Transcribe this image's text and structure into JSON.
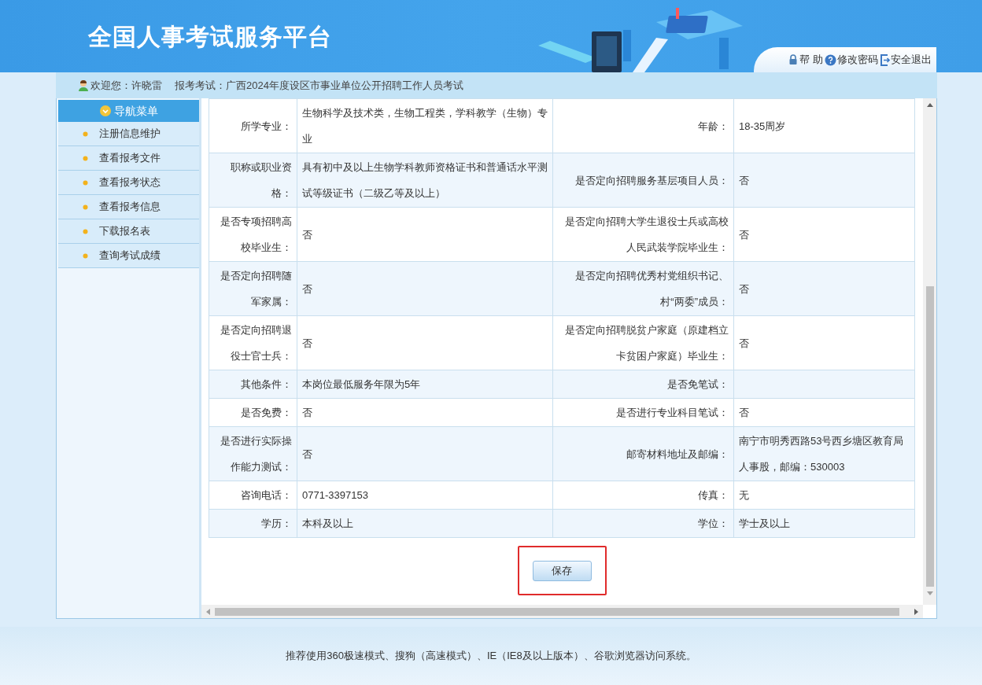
{
  "header": {
    "title": "全国人事考试服务平台",
    "links": [
      {
        "kind": "lock",
        "label": "帮 助"
      },
      {
        "kind": "help",
        "label": "修改密码"
      },
      {
        "kind": "exit",
        "label": "安全退出"
      }
    ]
  },
  "info_bar": {
    "welcome": "欢迎您：许晓雷",
    "exam": "报考考试：广西2024年度设区市事业单位公开招聘工作人员考试"
  },
  "sidebar": {
    "title": "导航菜单",
    "items": [
      "注册信息维护",
      "查看报考文件",
      "查看报考状态",
      "查看报考信息",
      "下载报名表",
      "查询考试成绩"
    ]
  },
  "table": {
    "rows": [
      {
        "fields": [
          {
            "label": "所学专业：",
            "value": "生物科学及技术类，生物工程类，学科教学（生物）专业"
          },
          {
            "label": "年龄：",
            "value": "18-35周岁"
          }
        ]
      },
      {
        "fields": [
          {
            "label": "职称或职业资格：",
            "value": "具有初中及以上生物学科教师资格证书和普通话水平测试等级证书（二级乙等及以上）"
          },
          {
            "label": "是否定向招聘服务基层项目人员：",
            "value": "否"
          }
        ]
      },
      {
        "fields": [
          {
            "label": "是否专项招聘高校毕业生：",
            "value": "否"
          },
          {
            "label": "是否定向招聘大学生退役士兵或高校人民武装学院毕业生：",
            "value": "否"
          }
        ]
      },
      {
        "fields": [
          {
            "label": "是否定向招聘随军家属：",
            "value": "否"
          },
          {
            "label": "是否定向招聘优秀村党组织书记、村“两委”成员：",
            "value": "否"
          }
        ]
      },
      {
        "fields": [
          {
            "label": "是否定向招聘退役士官士兵：",
            "value": "否"
          },
          {
            "label": "是否定向招聘脱贫户家庭（原建档立卡贫困户家庭）毕业生：",
            "value": "否"
          }
        ]
      },
      {
        "fields": [
          {
            "label": "其他条件：",
            "value": "本岗位最低服务年限为5年"
          },
          {
            "label": "是否免笔试："
          }
        ]
      },
      {
        "fields": [
          {
            "label": "是否免费：",
            "value": "否"
          },
          {
            "label": "是否进行专业科目笔试：",
            "value": "否"
          }
        ]
      },
      {
        "fields": [
          {
            "label": "是否进行实际操作能力测试：",
            "value": "否"
          },
          {
            "label": "邮寄材料地址及邮编：",
            "value": "南宁市明秀西路53号西乡塘区教育局人事股，邮编：530003"
          }
        ]
      },
      {
        "fields": [
          {
            "label": "咨询电话：",
            "value": "0771-3397153"
          },
          {
            "label": "传真：",
            "value": "无"
          }
        ]
      },
      {
        "fields": [
          {
            "label": "学历：",
            "value": "本科及以上"
          },
          {
            "label": "学位：",
            "value": "学士及以上"
          }
        ]
      }
    ]
  },
  "save_button": {
    "label": "保存",
    "highlighted": true
  },
  "footer": "推荐使用360极速模式、搜狗（高速模式）、IE（IE8及以上版本）、谷歌浏览器访问系统。"
}
